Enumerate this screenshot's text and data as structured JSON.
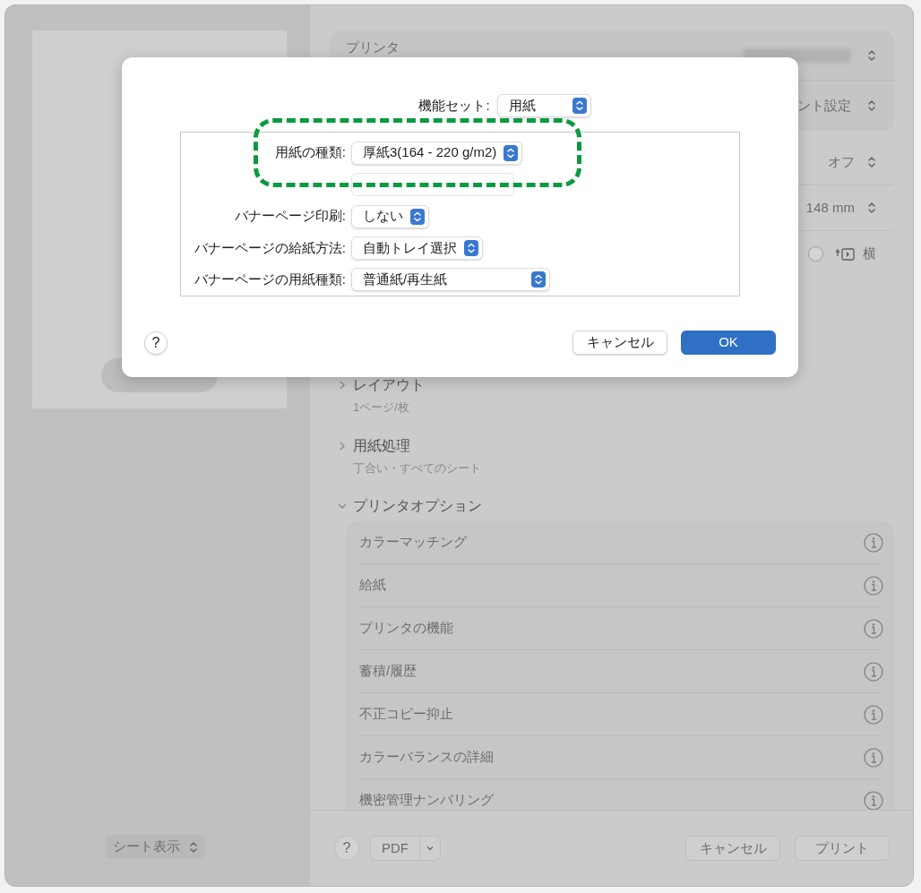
{
  "sidebar": {
    "sheet_view": "シート表示"
  },
  "printer_card": {
    "printer_label": "プリンタ",
    "presets_value": "ント設定"
  },
  "settings_rows": [
    {
      "kind": "popup",
      "value": "オフ"
    },
    {
      "kind": "popup",
      "value": "148 mm"
    },
    {
      "kind": "orientation",
      "value": "横",
      "selected": false
    }
  ],
  "sections": [
    {
      "title": "レイアウト",
      "subtitle": "1ページ/枚",
      "expanded": false
    },
    {
      "title": "用紙処理",
      "subtitle": "丁合い・すべてのシート",
      "expanded": false
    },
    {
      "title": "プリンタオプション",
      "expanded": true,
      "items": [
        "カラーマッチング",
        "給紙",
        "プリンタの機能",
        "蓄積/履歴",
        "不正コピー抑止",
        "カラーバランスの詳細",
        "機密管理ナンバリング"
      ]
    }
  ],
  "footer": {
    "help": "?",
    "pdf": "PDF",
    "cancel": "キャンセル",
    "print": "プリント"
  },
  "dialog": {
    "feature_set_label": "機能セット:",
    "feature_set_value": "用紙",
    "fields": [
      {
        "kind": "popup",
        "label": "用紙の種類:",
        "value": "厚紙3(164 - 220 g/m2)"
      },
      {
        "kind": "hidden"
      },
      {
        "kind": "popup",
        "label": "バナーページ印刷:",
        "value": "しない"
      },
      {
        "kind": "popup",
        "label": "バナーページの給紙方法:",
        "value": "自動トレイ選択"
      },
      {
        "kind": "popup",
        "label": "バナーページの用紙種類:",
        "value": "普通紙/再生紙",
        "wide": true
      }
    ],
    "highlight_frame": true,
    "help": "?",
    "cancel": "キャンセル",
    "ok": "OK"
  }
}
